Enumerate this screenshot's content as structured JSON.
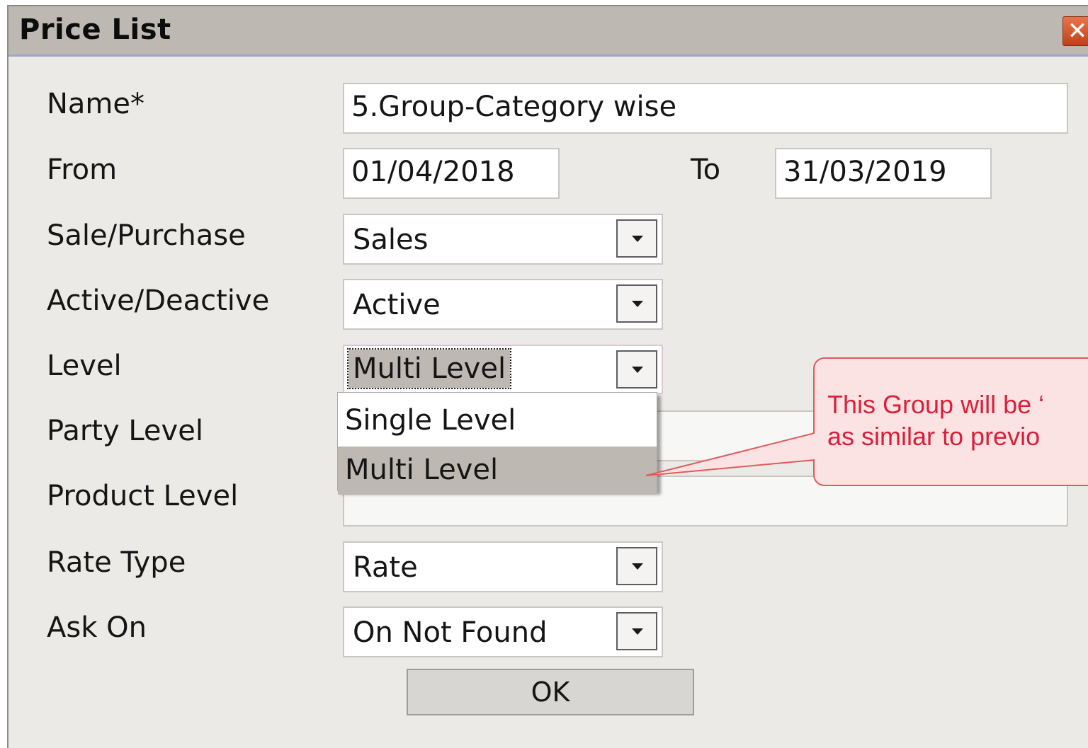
{
  "window": {
    "title": "Price List",
    "close_icon": "close-icon"
  },
  "form": {
    "name_label": "Name*",
    "name_value": "5.Group-Category wise",
    "from_label": "From",
    "from_value": "01/04/2018",
    "to_label": "To",
    "to_value": "31/03/2019",
    "sale_purchase_label": "Sale/Purchase",
    "sale_purchase_value": "Sales",
    "active_label": "Active/Deactive",
    "active_value": "Active",
    "level_label": "Level",
    "level_value": "Multi Level",
    "level_options": [
      "Single Level",
      "Multi Level"
    ],
    "party_level_label": "Party Level",
    "product_level_label": "Product Level",
    "rate_type_label": "Rate Type",
    "rate_type_value": "Rate",
    "ask_on_label": "Ask On",
    "ask_on_value": "On Not Found",
    "ok_label": "OK"
  },
  "callout": {
    "line1": "This Group will be ‘",
    "line2": "as similar to previo"
  },
  "colors": {
    "titlebar": "#bdb9b2",
    "dialog_bg": "#eceae7",
    "callout_fill": "#fbe3e4",
    "callout_border": "#e2595d",
    "callout_text": "#d8203a"
  }
}
